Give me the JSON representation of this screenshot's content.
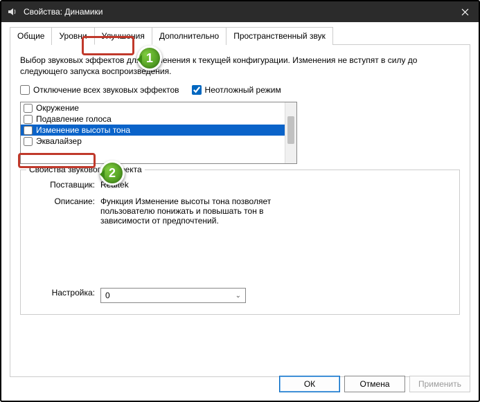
{
  "window": {
    "title": "Свойства: Динамики"
  },
  "tabs": {
    "general": "Общие",
    "levels": "Уровни",
    "enhancements": "Улучшения",
    "advanced": "Дополнительно",
    "spatial": "Пространственный звук"
  },
  "panel": {
    "description": "Выбор звуковых эффектов для применения к текущей конфигурации. Изменения не вступят в силу до следующего запуска воспроизведения.",
    "disable_all": "Отключение всех звуковых эффектов",
    "immediate_mode": "Неотложный режим"
  },
  "effects": {
    "items": [
      {
        "label": "Окружение",
        "checked": false,
        "selected": false
      },
      {
        "label": "Подавление голоса",
        "checked": false,
        "selected": false
      },
      {
        "label": "Изменение высоты тона",
        "checked": false,
        "selected": true
      },
      {
        "label": "Эквалайзер",
        "checked": false,
        "selected": false
      }
    ]
  },
  "group": {
    "title": "Свойства звукового эффекта",
    "provider_label": "Поставщик:",
    "provider_value": "Realtek",
    "desc_label": "Описание:",
    "desc_value": "Функция Изменение высоты тона позволяет пользователю понижать и повышать тон в зависимости от предпочтений.",
    "setting_label": "Настройка:",
    "setting_value": "0"
  },
  "buttons": {
    "ok": "ОК",
    "cancel": "Отмена",
    "apply": "Применить"
  },
  "callouts": {
    "one": "1",
    "two": "2"
  }
}
